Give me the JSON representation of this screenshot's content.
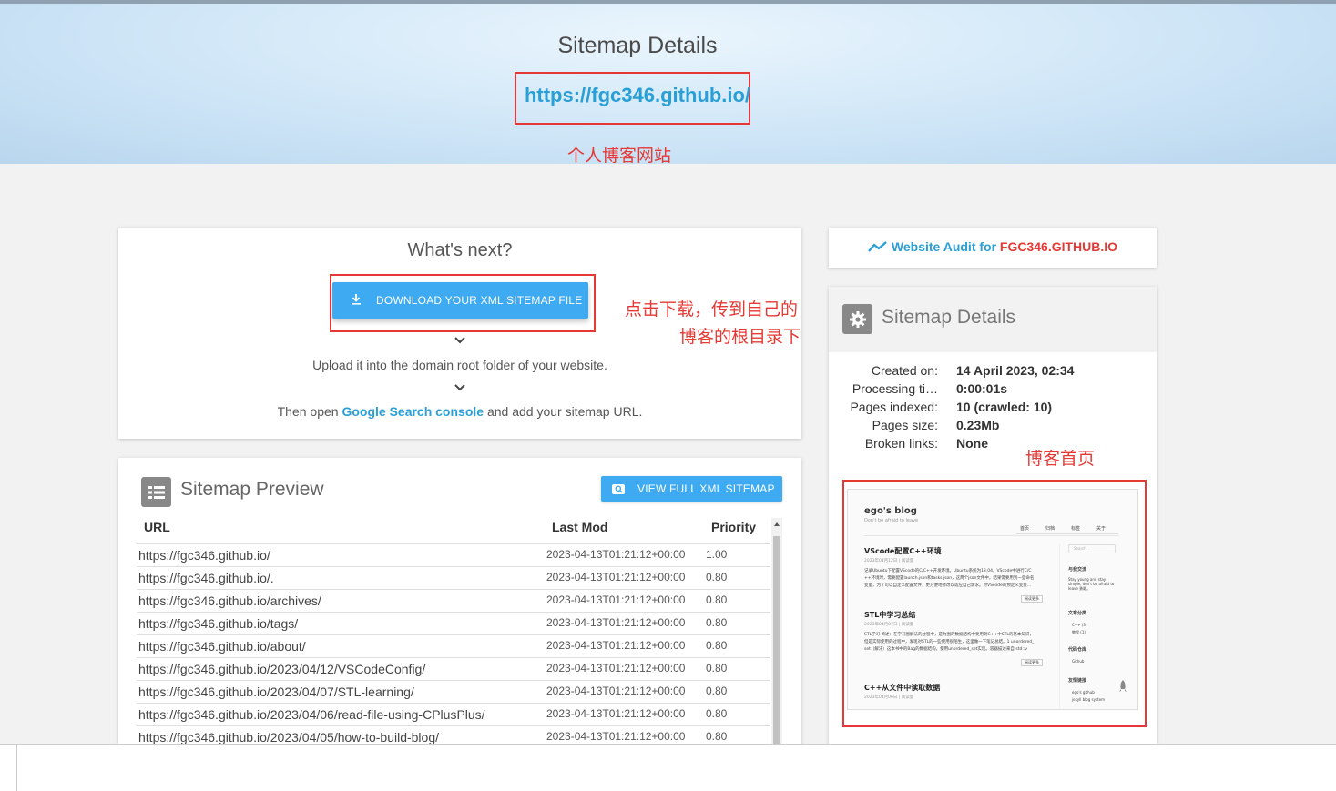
{
  "hero": {
    "title": "Sitemap Details",
    "url": "https://fgc346.github.io/",
    "annotation": "个人博客网站"
  },
  "next_card": {
    "title": "What's next?",
    "download_label": "DOWNLOAD YOUR XML SITEMAP FILE",
    "annotation_line1": "点击下载，传到自己的",
    "annotation_line2": "博客的根目录下",
    "step1": "Upload it into the domain root folder of your website.",
    "step2_prefix": "Then open ",
    "step2_link": "Google Search console",
    "step2_suffix": " and add your sitemap URL."
  },
  "preview": {
    "title": "Sitemap Preview",
    "view_full_label": "VIEW FULL XML SITEMAP",
    "columns": [
      "URL",
      "Last Mod",
      "Priority"
    ],
    "rows": [
      {
        "url": "https://fgc346.github.io/",
        "lastmod": "2023-04-13T01:21:12+00:00",
        "priority": "1.00"
      },
      {
        "url": "https://fgc346.github.io/.",
        "lastmod": "2023-04-13T01:21:12+00:00",
        "priority": "0.80"
      },
      {
        "url": "https://fgc346.github.io/archives/",
        "lastmod": "2023-04-13T01:21:12+00:00",
        "priority": "0.80"
      },
      {
        "url": "https://fgc346.github.io/tags/",
        "lastmod": "2023-04-13T01:21:12+00:00",
        "priority": "0.80"
      },
      {
        "url": "https://fgc346.github.io/about/",
        "lastmod": "2023-04-13T01:21:12+00:00",
        "priority": "0.80"
      },
      {
        "url": "https://fgc346.github.io/2023/04/12/VSCodeConfig/",
        "lastmod": "2023-04-13T01:21:12+00:00",
        "priority": "0.80"
      },
      {
        "url": "https://fgc346.github.io/2023/04/07/STL-learning/",
        "lastmod": "2023-04-13T01:21:12+00:00",
        "priority": "0.80"
      },
      {
        "url": "https://fgc346.github.io/2023/04/06/read-file-using-CPlusPlus/",
        "lastmod": "2023-04-13T01:21:12+00:00",
        "priority": "0.80"
      },
      {
        "url": "https://fgc346.github.io/2023/04/05/how-to-build-blog/",
        "lastmod": "2023-04-13T01:21:12+00:00",
        "priority": "0.80"
      }
    ]
  },
  "audit": {
    "prefix": "Website Audit for ",
    "domain": "FGC346.GITHUB.IO"
  },
  "details": {
    "title": "Sitemap Details",
    "created_label": "Created on:",
    "created_value": "14 April 2023, 02:34",
    "processing_label": "Processing ti…",
    "processing_value": "0:00:01s",
    "pages_label": "Pages indexed:",
    "pages_value": "10 (crawled: 10)",
    "size_label": "Pages size:",
    "size_value": "0.23Mb",
    "broken_label": "Broken links:",
    "broken_value": "None",
    "annotation": "博客首页"
  },
  "thumbnail": {
    "blog_title": "ego's blog",
    "blog_subtitle": "Don't be afraid to leave",
    "nav": [
      "首页",
      "归档",
      "标签",
      "关于"
    ],
    "search": "Search",
    "post1_title": "VScode配置C++环境",
    "post1_meta": "2023年04月12日 | 阅读量",
    "post1_body1": "记录Ubuntu下配置VScode的C/C++开发环境。Ubuntu系统为18.04。VScode中进行C/C",
    "post1_body2": "++环境时，需要配置launch.json和tasks.json，这两个json文件中，结果需要用到一些命名",
    "post1_body3": "变量，为了可以自定义配置文件，更方便地修改以适应自己需求。对VScode的预定义变量...",
    "post2_title": "STL中学习总结",
    "post2_meta": "2023年04月07日 | 阅读量",
    "post2_body1": "STL学习 简述：在学习图解法的过程中，是为图的数据结构中要用到C++中STL的基本知识，",
    "post2_body2": "但是实际使用的过程中，发现对STL的一些使用很陌生，这里做一下笔记总结。1 unordered_",
    "post2_body3": "set（解法）这本书中的Bag的数据结构，使用unordered_set实现。容器描述来自 std::v",
    "post3_title": "C++从文件中读取数据",
    "post3_meta": "2023年04月06日 | 阅读量",
    "read_more": "阅读更多",
    "side_about": "与我交流",
    "side_about_text": "Stay young and stay simple, don't be afraid to leave 勇敢。",
    "side_cat": "文章分类",
    "side_cat_items": [
      "C++ (3)",
      "教程 (1)"
    ],
    "side_repo": "代码仓库",
    "side_repo_item": "Github",
    "side_links": "友情链接",
    "side_links_items": [
      "ego's github",
      "jekyll blog system"
    ]
  }
}
